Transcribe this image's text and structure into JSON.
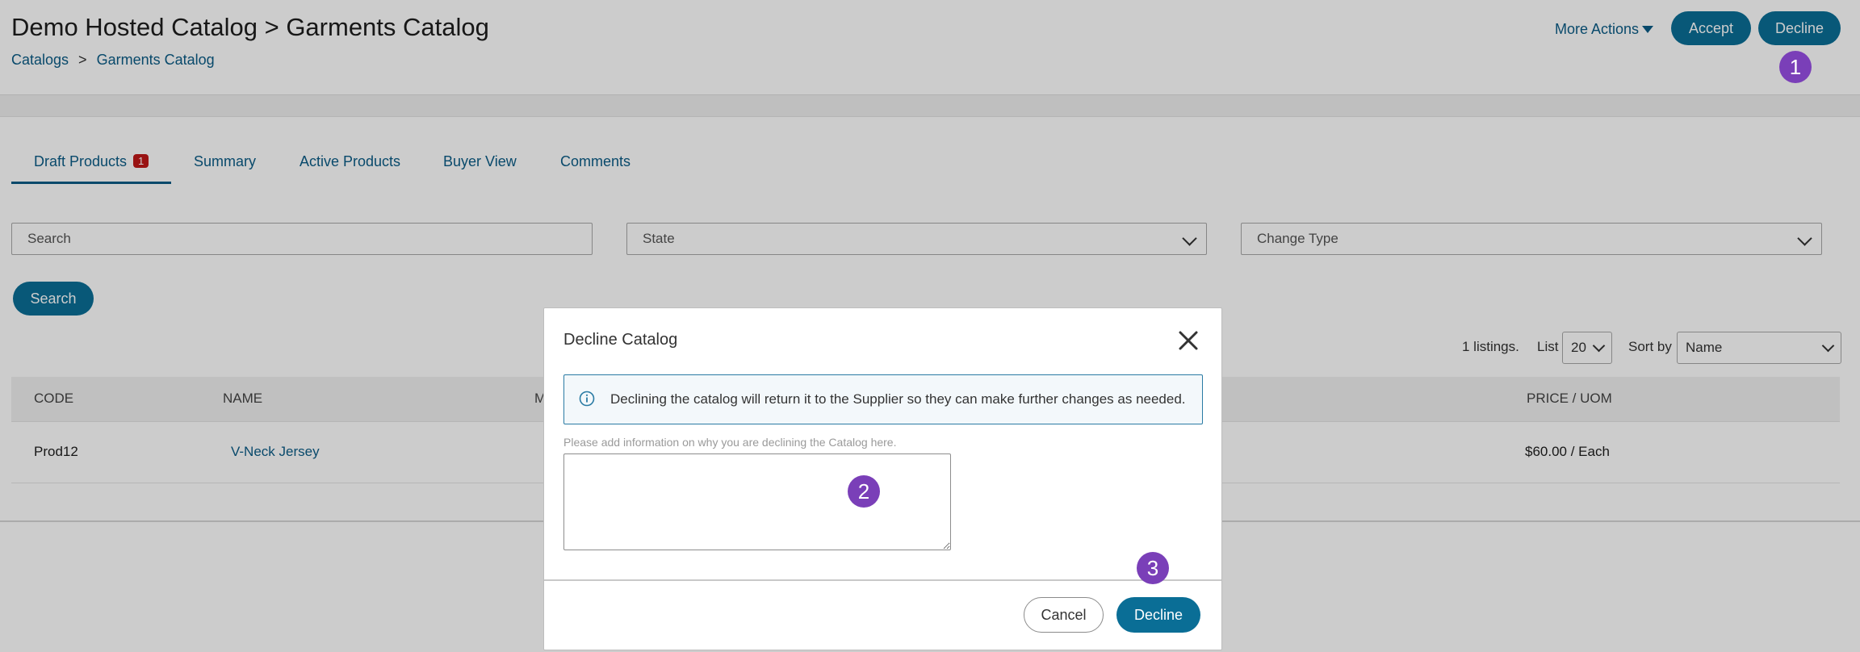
{
  "header": {
    "title": "Demo Hosted Catalog > Garments Catalog",
    "breadcrumb": {
      "root": "Catalogs",
      "separator": ">",
      "current": "Garments Catalog"
    },
    "more_actions_label": "More Actions",
    "accept_label": "Accept",
    "decline_label": "Decline"
  },
  "tabs": [
    {
      "label": "Draft Products",
      "badge": "1",
      "active": true
    },
    {
      "label": "Summary"
    },
    {
      "label": "Active Products"
    },
    {
      "label": "Buyer View"
    },
    {
      "label": "Comments"
    }
  ],
  "filters": {
    "search_placeholder": "Search",
    "state_label": "State",
    "change_type_label": "Change Type",
    "search_button_label": "Search"
  },
  "listing": {
    "count_text": "1 listings.",
    "list_label": "List",
    "list_value": "20",
    "sort_label": "Sort by",
    "sort_value": "Name"
  },
  "table": {
    "columns": {
      "code": "CODE",
      "name": "NAME",
      "partial": "M",
      "price": "PRICE / UOM"
    },
    "rows": [
      {
        "code": "Prod12",
        "name": "V-Neck Jersey",
        "price": "$60.00 / Each"
      }
    ]
  },
  "modal": {
    "title": "Decline Catalog",
    "info_text": "Declining the catalog will return it to the Supplier so they can make further changes as needed.",
    "help_text": "Please add information on why you are declining the Catalog here.",
    "textarea_value": "",
    "cancel_label": "Cancel",
    "decline_label": "Decline"
  },
  "markers": [
    "1",
    "2",
    "3"
  ],
  "colors": {
    "primary": "#0a6e96",
    "link": "#0b5c86",
    "badge": "#c01818",
    "marker": "#7a3fb8"
  }
}
